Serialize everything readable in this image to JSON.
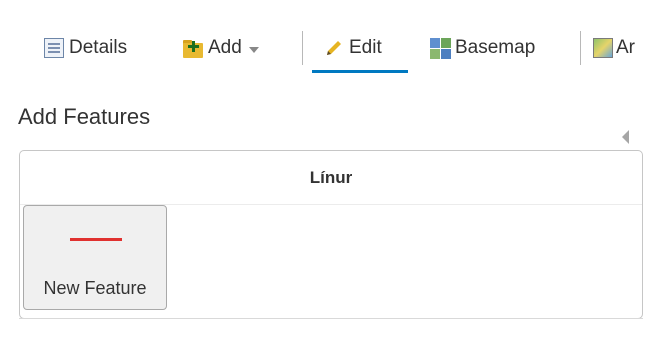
{
  "toolbar": {
    "details_label": "Details",
    "add_label": "Add",
    "edit_label": "Edit",
    "basemap_label": "Basemap",
    "analysis_label": "Ar",
    "accent_color": "#0079c1"
  },
  "icons": {
    "details": "details-icon",
    "add": "add-folder-icon",
    "edit": "pencil-icon",
    "basemap": "basemap-grid-icon",
    "analysis": "analysis-map-icon",
    "collapse": "collapse-arrow-icon",
    "dropdown": "chevron-down-icon"
  },
  "panel": {
    "title": "Add Features",
    "template_group": "Línur",
    "templates": [
      {
        "label": "New Feature",
        "symbol": "line",
        "symbol_color": "#e0312f"
      }
    ]
  }
}
